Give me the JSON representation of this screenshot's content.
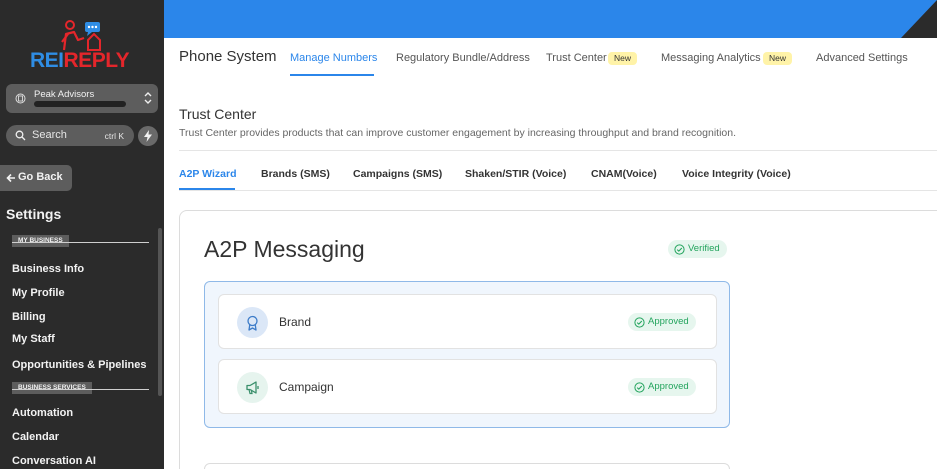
{
  "brand": {
    "rei": "REI",
    "reply": "REPLY"
  },
  "account": {
    "name": "Peak Advisors"
  },
  "search": {
    "label": "Search",
    "shortcut": "ctrl K"
  },
  "sidebar": {
    "back_label": "Go Back",
    "title": "Settings",
    "sections": [
      {
        "label": "MY BUSINESS",
        "items": [
          "Business Info",
          "My Profile",
          "Billing",
          "My Staff",
          "Opportunities & Pipelines"
        ]
      },
      {
        "label": "BUSINESS SERVICES",
        "items": [
          "Automation",
          "Calendar",
          "Conversation AI"
        ]
      }
    ]
  },
  "topnav": {
    "title": "Phone System",
    "links": [
      {
        "label": "Manage Numbers",
        "active": true
      },
      {
        "label": "Regulatory Bundle/Address",
        "active": false
      },
      {
        "label": "Trust Center",
        "badge": "New"
      },
      {
        "label": "Messaging Analytics",
        "badge": "New"
      },
      {
        "label": "Advanced Settings"
      }
    ]
  },
  "page": {
    "title": "Trust Center",
    "description": "Trust Center provides products that can improve customer engagement by increasing throughput and brand recognition."
  },
  "subtabs": [
    "A2P Wizard",
    "Brands (SMS)",
    "Campaigns (SMS)",
    "Shaken/STIR (Voice)",
    "CNAM(Voice)",
    "Voice Integrity (Voice)"
  ],
  "a2p": {
    "title": "A2P Messaging",
    "status": "Verified",
    "items": [
      {
        "label": "Brand",
        "status": "Approved",
        "icon": "award-icon"
      },
      {
        "label": "Campaign",
        "status": "Approved",
        "icon": "megaphone-icon"
      }
    ]
  },
  "colors": {
    "accent": "#2b86ea",
    "sidebar": "#2b2b2b",
    "success": "#23a45d",
    "badge": "#fff3a8"
  }
}
